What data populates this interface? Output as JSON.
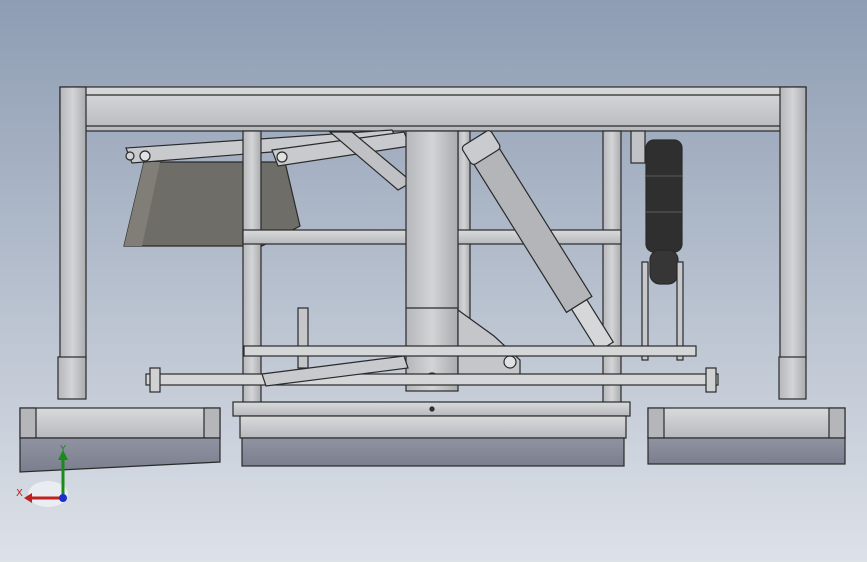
{
  "triad": {
    "x_label": "X",
    "y_label": "Y"
  },
  "colors": {
    "bg_top": "#8e9db3",
    "bg_bottom": "#d9dee6",
    "frame": "#c3c5c8",
    "frame_dark": "#a9abae",
    "edge": "#2a2a2a",
    "hopper": "#6e6c66",
    "cylinder": "#b4b6b9",
    "rubber": "#2e2e2e",
    "blade": "#8a8e9c",
    "axis_x": "#c02020",
    "axis_y": "#1a8a1a",
    "axis_z": "#1a2fd0"
  }
}
